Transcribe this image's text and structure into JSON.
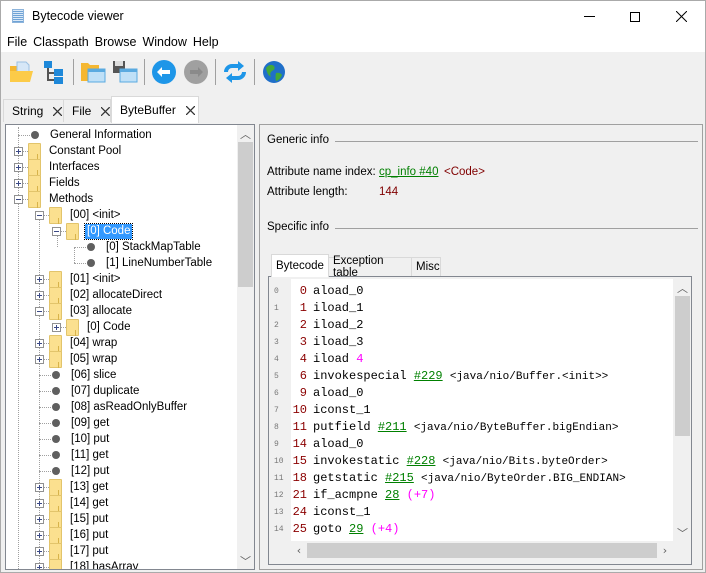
{
  "window": {
    "title": "Bytecode viewer"
  },
  "menu": [
    "File",
    "Classpath",
    "Browse",
    "Window",
    "Help"
  ],
  "toolbar": {
    "buttons": [
      {
        "name": "open-class-icon"
      },
      {
        "name": "browse-classpath-icon"
      },
      {
        "name": "open-window-icon"
      },
      {
        "name": "save-window-icon"
      },
      {
        "name": "back-icon"
      },
      {
        "name": "forward-icon"
      },
      {
        "name": "reload-icon"
      },
      {
        "name": "web-icon"
      }
    ]
  },
  "tabs": [
    {
      "label": "String",
      "active": false
    },
    {
      "label": "File",
      "active": false
    },
    {
      "label": "ByteBuffer",
      "active": true
    }
  ],
  "tree": {
    "items": [
      {
        "label": "General Information",
        "level": 0,
        "type": "leaf"
      },
      {
        "label": "Constant Pool",
        "level": 0,
        "type": "folder",
        "expander": "plus"
      },
      {
        "label": "Interfaces",
        "level": 0,
        "type": "folder",
        "expander": "plus"
      },
      {
        "label": "Fields",
        "level": 0,
        "type": "folder",
        "expander": "plus"
      },
      {
        "label": "Methods",
        "level": 0,
        "type": "folder",
        "expander": "minus"
      },
      {
        "label": "[00] <init>",
        "level": 1,
        "type": "folder",
        "expander": "minus"
      },
      {
        "label": "[0] Code",
        "level": 2,
        "type": "folder",
        "expander": "minus",
        "selected": true
      },
      {
        "label": "[0] StackMapTable",
        "level": 3,
        "type": "leaf"
      },
      {
        "label": "[1] LineNumberTable",
        "level": 3,
        "type": "leaf"
      },
      {
        "label": "[01] <init>",
        "level": 1,
        "type": "folder",
        "expander": "plus"
      },
      {
        "label": "[02] allocateDirect",
        "level": 1,
        "type": "folder",
        "expander": "plus"
      },
      {
        "label": "[03] allocate",
        "level": 1,
        "type": "folder",
        "expander": "minus"
      },
      {
        "label": "[0] Code",
        "level": 2,
        "type": "folder",
        "expander": "plus"
      },
      {
        "label": "[04] wrap",
        "level": 1,
        "type": "folder",
        "expander": "plus"
      },
      {
        "label": "[05] wrap",
        "level": 1,
        "type": "folder",
        "expander": "plus"
      },
      {
        "label": "[06] slice",
        "level": 1,
        "type": "leaf"
      },
      {
        "label": "[07] duplicate",
        "level": 1,
        "type": "leaf"
      },
      {
        "label": "[08] asReadOnlyBuffer",
        "level": 1,
        "type": "leaf"
      },
      {
        "label": "[09] get",
        "level": 1,
        "type": "leaf"
      },
      {
        "label": "[10] put",
        "level": 1,
        "type": "leaf"
      },
      {
        "label": "[11] get",
        "level": 1,
        "type": "leaf"
      },
      {
        "label": "[12] put",
        "level": 1,
        "type": "leaf"
      },
      {
        "label": "[13] get",
        "level": 1,
        "type": "folder",
        "expander": "plus"
      },
      {
        "label": "[14] get",
        "level": 1,
        "type": "folder",
        "expander": "plus"
      },
      {
        "label": "[15] put",
        "level": 1,
        "type": "folder",
        "expander": "plus"
      },
      {
        "label": "[16] put",
        "level": 1,
        "type": "folder",
        "expander": "plus"
      },
      {
        "label": "[17] put",
        "level": 1,
        "type": "folder",
        "expander": "plus"
      },
      {
        "label": "[18] hasArray",
        "level": 1,
        "type": "folder",
        "expander": "plus"
      }
    ]
  },
  "generic_info": {
    "title": "Generic info",
    "attr_name_index_label": "Attribute name index:",
    "attr_name_index_link": "cp_info #40",
    "attr_name_index_value": "<Code>",
    "attr_length_label": "Attribute length:",
    "attr_length_value": "144"
  },
  "specific_info": {
    "title": "Specific info",
    "tabs": [
      {
        "label": "Bytecode",
        "active": true
      },
      {
        "label": "Exception table",
        "active": false
      },
      {
        "label": "Misc",
        "active": false
      }
    ]
  },
  "bytecode": [
    {
      "line": "0",
      "offset": "0",
      "instr": "aload_0"
    },
    {
      "line": "1",
      "offset": "1",
      "instr": "iload_1"
    },
    {
      "line": "2",
      "offset": "2",
      "instr": "iload_2"
    },
    {
      "line": "3",
      "offset": "3",
      "instr": "iload_3"
    },
    {
      "line": "4",
      "offset": "4",
      "instr": "iload",
      "num": "4"
    },
    {
      "line": "5",
      "offset": "6",
      "instr": "invokespecial",
      "ref": "#229",
      "comment": "<java/nio/Buffer.<init>>"
    },
    {
      "line": "6",
      "offset": "9",
      "instr": "aload_0"
    },
    {
      "line": "7",
      "offset": "10",
      "instr": "iconst_1"
    },
    {
      "line": "8",
      "offset": "11",
      "instr": "putfield",
      "ref": "#211",
      "comment": "<java/nio/ByteBuffer.bigEndian>"
    },
    {
      "line": "9",
      "offset": "14",
      "instr": "aload_0"
    },
    {
      "line": "10",
      "offset": "15",
      "instr": "invokestatic",
      "ref": "#228",
      "comment": "<java/nio/Bits.byteOrder>"
    },
    {
      "line": "11",
      "offset": "18",
      "instr": "getstatic",
      "ref": "#215",
      "comment": "<java/nio/ByteOrder.BIG_ENDIAN>"
    },
    {
      "line": "12",
      "offset": "21",
      "instr": "if_acmpne",
      "ref": "28",
      "num": "(+7)"
    },
    {
      "line": "13",
      "offset": "24",
      "instr": "iconst_1"
    },
    {
      "line": "14",
      "offset": "25",
      "instr": "goto",
      "ref": "29",
      "num": "(+4)"
    }
  ],
  "colors": {
    "selection": "#3399ff",
    "link": "#008000",
    "offset": "#8b0000",
    "number": "#ff00ff"
  }
}
